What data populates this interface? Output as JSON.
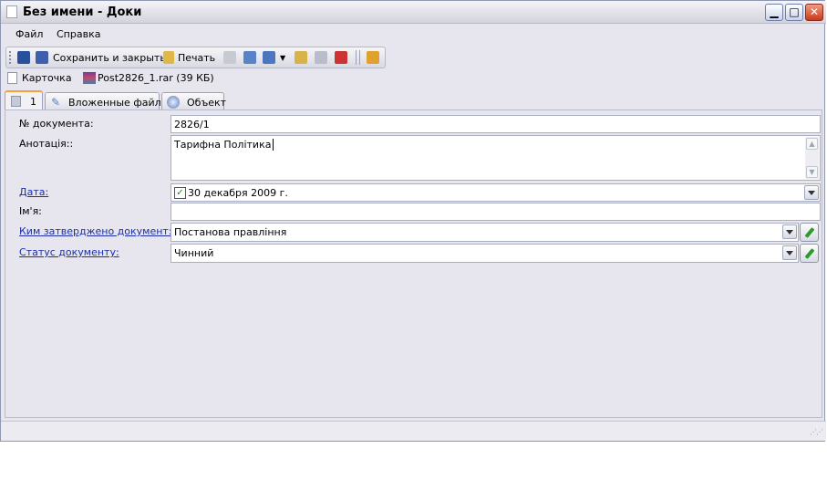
{
  "window": {
    "title": "Без имени - Доки"
  },
  "menu": {
    "items": [
      "Файл",
      "Справка"
    ]
  },
  "toolbar": {
    "save_close_label": "Сохранить и закрыть",
    "print_label": "Печать"
  },
  "attachments": {
    "card_label": "Карточка",
    "file_label": "Post2826_1.rar (39 КБ)"
  },
  "tabs": [
    {
      "label": "1"
    },
    {
      "label": "Вложенные файлы"
    },
    {
      "label": "Объект"
    }
  ],
  "form": {
    "doc_number_label": "№ документа:",
    "doc_number_value": "2826/1",
    "annotation_label": "Анотація::",
    "annotation_value": "Тарифна Політика",
    "date_label": "Дата:",
    "date_value": "30 декабря  2009 г.",
    "date_checked": true,
    "name_label": "Ім'я:",
    "name_value": "",
    "approved_by_label": "Ким затверджено документ:",
    "approved_by_value": "Постанова правління",
    "status_label": "Статус документу:",
    "status_value": "Чинний"
  },
  "colors": {
    "link": "#1c2fa8",
    "window_bg": "#e7e6ee",
    "tab_accent": "#f0a33a",
    "close_button": "#c8391d"
  }
}
